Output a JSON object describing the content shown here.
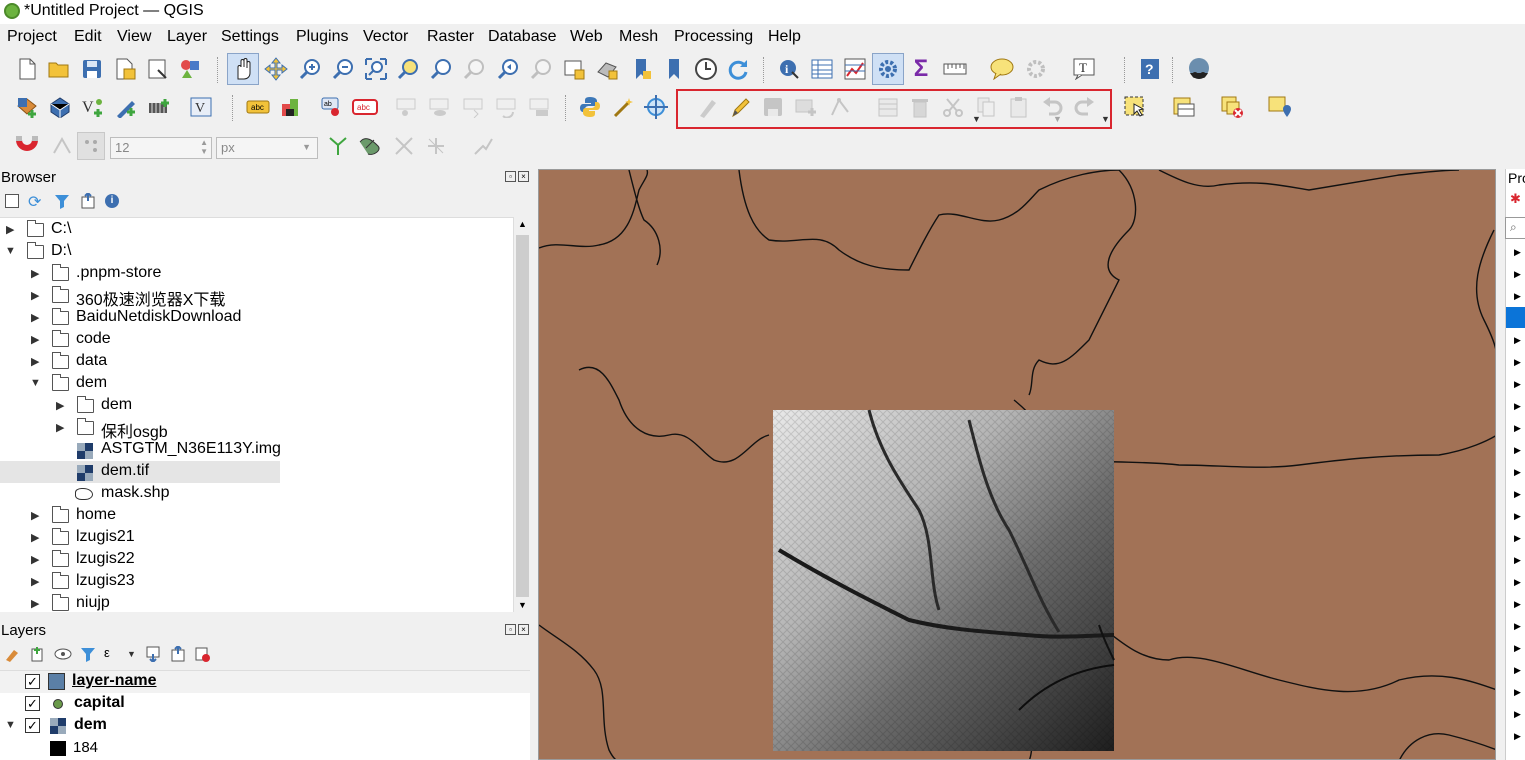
{
  "window": {
    "title": "*Untitled Project — QGIS"
  },
  "menu": [
    "Project",
    "Edit",
    "View",
    "Layer",
    "Settings",
    "Plugins",
    "Vector",
    "Raster",
    "Database",
    "Web",
    "Mesh",
    "Processing",
    "Help"
  ],
  "snapping": {
    "tolerance": "12",
    "unit": "px"
  },
  "browser": {
    "title": "Browser",
    "items": [
      {
        "label": "C:\\",
        "type": "folder",
        "level": 0,
        "expanded": false
      },
      {
        "label": "D:\\",
        "type": "folder",
        "level": 0,
        "expanded": true
      },
      {
        "label": ".pnpm-store",
        "type": "folder",
        "level": 1,
        "expanded": false
      },
      {
        "label": "360极速浏览器X下载",
        "type": "folder",
        "level": 1,
        "expanded": false
      },
      {
        "label": "BaiduNetdiskDownload",
        "type": "folder",
        "level": 1,
        "expanded": false
      },
      {
        "label": "code",
        "type": "folder",
        "level": 1,
        "expanded": false
      },
      {
        "label": "data",
        "type": "folder",
        "level": 1,
        "expanded": false
      },
      {
        "label": "dem",
        "type": "folder",
        "level": 1,
        "expanded": true
      },
      {
        "label": "dem",
        "type": "folder",
        "level": 2,
        "expanded": false
      },
      {
        "label": "保利osgb",
        "type": "folder",
        "level": 2,
        "expanded": false
      },
      {
        "label": "ASTGTM_N36E113Y.img",
        "type": "raster",
        "level": 2
      },
      {
        "label": "dem.tif",
        "type": "raster",
        "level": 2,
        "selected": true
      },
      {
        "label": "mask.shp",
        "type": "vector",
        "level": 2
      },
      {
        "label": "home",
        "type": "folder",
        "level": 1,
        "expanded": false
      },
      {
        "label": "lzugis21",
        "type": "folder",
        "level": 1,
        "expanded": false
      },
      {
        "label": "lzugis22",
        "type": "folder",
        "level": 1,
        "expanded": false
      },
      {
        "label": "lzugis23",
        "type": "folder",
        "level": 1,
        "expanded": false
      },
      {
        "label": "niujp",
        "type": "folder",
        "level": 1,
        "expanded": false
      }
    ]
  },
  "layers": {
    "title": "Layers",
    "items": [
      {
        "label": "layer-name",
        "checked": true,
        "symbol": "fill",
        "color": "#5b7fa6"
      },
      {
        "label": "capital",
        "checked": true,
        "symbol": "point",
        "color": "#6a9a4a"
      },
      {
        "label": "dem",
        "checked": true,
        "symbol": "raster",
        "expanded": true
      }
    ],
    "legend_value": "184"
  },
  "right_dock": {
    "title": "Pro"
  },
  "colors": {
    "map_background": "#a27256",
    "edit_highlight": "#d9262f"
  }
}
